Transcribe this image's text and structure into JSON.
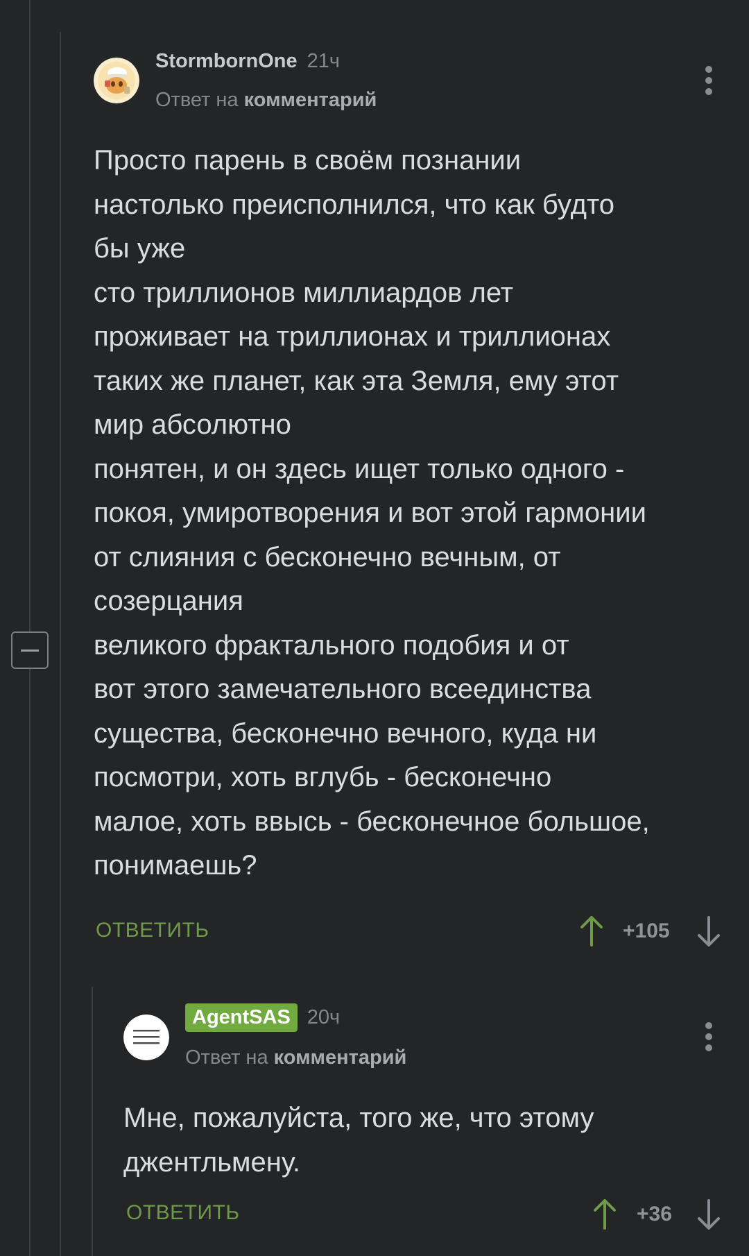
{
  "comments": [
    {
      "author": "StormbornOne",
      "time": "21ч",
      "reply_prefix": "Ответ на",
      "reply_link": "комментарий",
      "lines": [
        "Просто парень в своём познании",
        "настолько преисполнился, что как будто",
        "бы уже",
        "сто триллионов миллиардов лет",
        "проживает на триллионах и триллионах",
        "таких же планет, как эта Земля, ему этот",
        "мир абсолютно",
        "понятен, и он здесь ищет только одного -",
        "покоя, умиротворения и вот этой гармонии",
        "от слияния с бесконечно вечным, от",
        "созерцания",
        "великого фрактального подобия и от",
        "вот этого замечательного всеединства",
        "существа, бесконечно вечного, куда ни",
        "посмотри, хоть вглубь - бесконечно",
        "малое, хоть ввысь - бесконечное большое,",
        "понимаешь?"
      ],
      "reply_label": "ОТВЕТИТЬ",
      "score": "+105"
    },
    {
      "author": "AgentSAS",
      "time": "20ч",
      "reply_prefix": "Ответ на",
      "reply_link": "комментарий",
      "lines": [
        "Мне, пожалуйста, того же, что этому",
        "джентльмену."
      ],
      "reply_label": "ОТВЕТИТЬ",
      "score": "+36"
    }
  ],
  "icons": {
    "upvote": "arrow-up-icon",
    "downvote": "arrow-down-icon",
    "menu": "more-vertical-icon",
    "collapse": "minus-icon"
  },
  "colors": {
    "background": "#232527",
    "accent_green": "#71ab40",
    "reply_green": "#6f9a4a",
    "text": "#dadcdf",
    "muted": "#85888c"
  }
}
